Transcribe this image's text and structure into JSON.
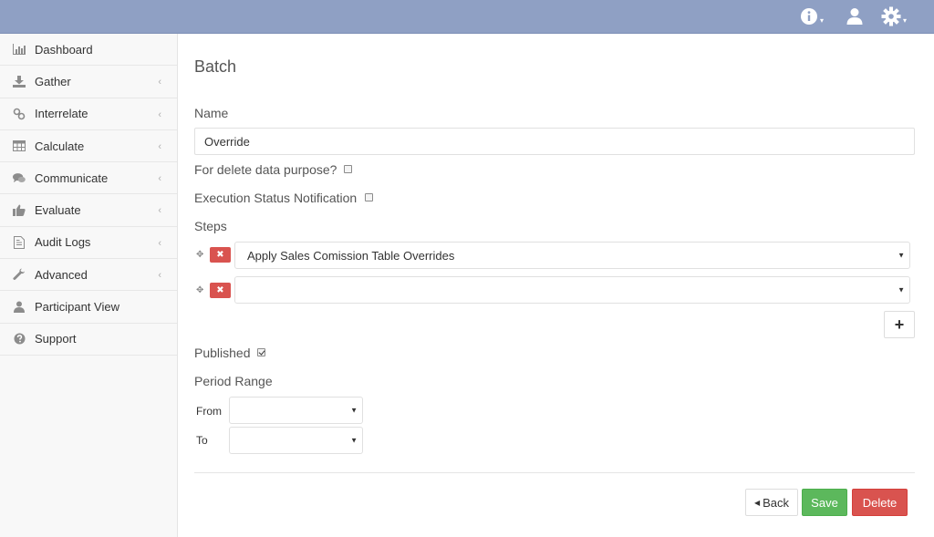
{
  "topbar": {
    "info_icon": "info-circle-icon",
    "user_icon": "user-icon",
    "settings_icon": "gear-icon",
    "caret": "▾"
  },
  "sidebar": {
    "items": [
      {
        "label": "Dashboard",
        "icon": "bar-chart-icon",
        "has_chevron": false
      },
      {
        "label": "Gather",
        "icon": "download-icon",
        "has_chevron": true
      },
      {
        "label": "Interrelate",
        "icon": "link-icon",
        "has_chevron": true
      },
      {
        "label": "Calculate",
        "icon": "table-icon",
        "has_chevron": true
      },
      {
        "label": "Communicate",
        "icon": "comments-icon",
        "has_chevron": true
      },
      {
        "label": "Evaluate",
        "icon": "thumbs-up-icon",
        "has_chevron": true
      },
      {
        "label": "Audit Logs",
        "icon": "file-icon",
        "has_chevron": true
      },
      {
        "label": "Advanced",
        "icon": "wrench-icon",
        "has_chevron": true
      },
      {
        "label": "Participant View",
        "icon": "user-icon",
        "has_chevron": false
      },
      {
        "label": "Support",
        "icon": "question-circle-icon",
        "has_chevron": false
      }
    ],
    "chevron": "‹"
  },
  "form": {
    "title": "Batch",
    "name_label": "Name",
    "name_value": "Override",
    "delete_purpose_label": "For delete data purpose?",
    "delete_purpose_checked": false,
    "exec_notify_label": "Execution Status Notification",
    "exec_notify_checked": false,
    "steps_label": "Steps",
    "steps": [
      {
        "value": "Apply Sales Comission Table Overrides"
      },
      {
        "value": ""
      }
    ],
    "remove_glyph": "✖",
    "drag_glyph": "✥",
    "add_glyph": "+",
    "published_label": "Published",
    "published_checked": true,
    "period_range_label": "Period Range",
    "from_label": "From",
    "from_value": "",
    "to_label": "To",
    "to_value": "",
    "select_arrow": "▼"
  },
  "actions": {
    "back_label": "Back",
    "back_glyph": "◀",
    "save_label": "Save",
    "delete_label": "Delete"
  },
  "colors": {
    "topbar": "#8fa0c4",
    "save": "#5cb85c",
    "danger": "#d9534f"
  }
}
